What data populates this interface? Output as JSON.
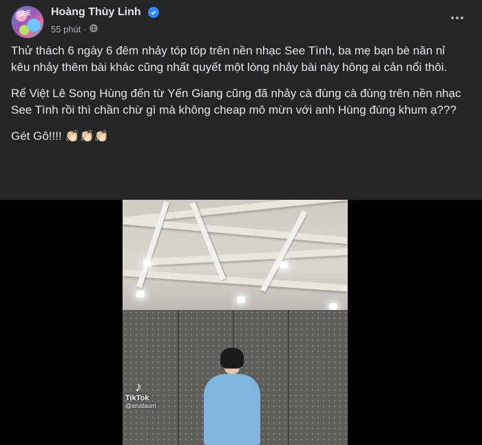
{
  "post": {
    "author": "Hoàng Thùy Linh",
    "time": "55 phút",
    "separator": "·",
    "paragraphs": [
      "Thử thách 6 ngày 6 đêm nhảy tóp tóp trên nền nhạc See Tình, ba mẹ bạn bè năn nỉ kêu nhảy thêm bài khác cũng nhất quyết một lòng nhảy bài này hông ai cản nổi thôi.",
      "Rể Việt Lê Song Hùng đến từ Yến Giang cũng đã nhảy cà đùng cà đùng trên nền nhạc See Tình rồi thì chần chừ gì mà không cheap mô mừn với anh Hùng đúng khum ạ???",
      "Gét Gô!!!! 👏🏻👏🏻👏🏻"
    ]
  },
  "video": {
    "watermark_brand": "TikTok",
    "watermark_user": "@arudaum"
  },
  "colors": {
    "background": "#242526",
    "text": "#e4e6eb",
    "secondary": "#b0b3b8",
    "verified": "#2d88ff"
  },
  "icons": [
    "verified-badge-icon",
    "globe-icon",
    "more-options-icon",
    "tiktok-logo-icon"
  ]
}
